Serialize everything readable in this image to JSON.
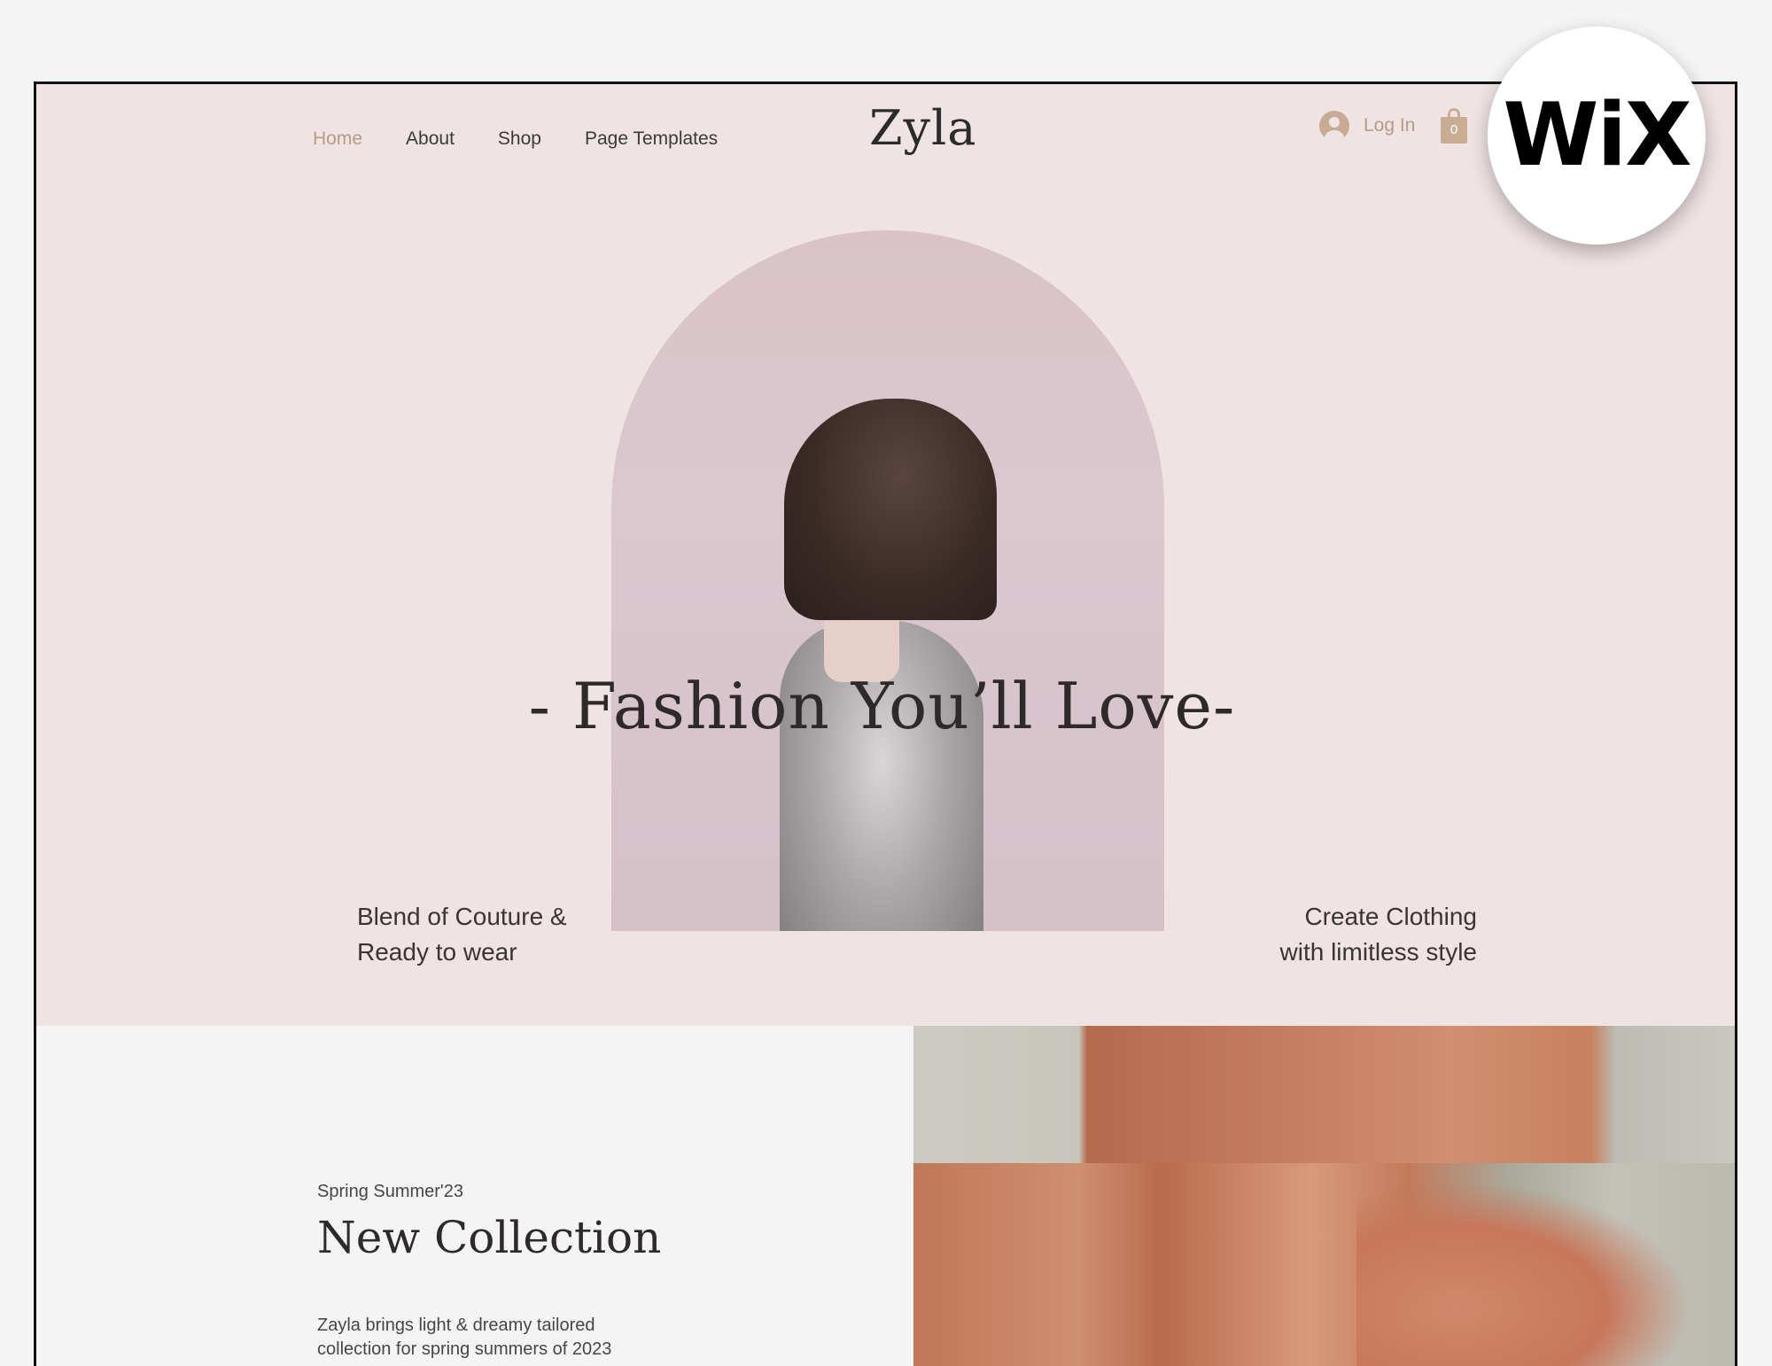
{
  "nav": {
    "items": [
      {
        "label": "Home",
        "active": true
      },
      {
        "label": "About"
      },
      {
        "label": "Shop"
      },
      {
        "label": "Page Templates"
      }
    ]
  },
  "header": {
    "logo": "Zyla",
    "login_label": "Log In",
    "cart_count": "0"
  },
  "hero": {
    "headline": "- Fashion You’ll Love-",
    "left_tagline": [
      "Blend of Couture &",
      "Ready to wear"
    ],
    "right_tagline": [
      "Create Clothing",
      "with limitless style"
    ]
  },
  "collection": {
    "season": "Spring Summer'23",
    "title": "New Collection",
    "description": "Zayla brings light & dreamy tailored collection for spring summers of 2023"
  },
  "badge": {
    "text": "WiX"
  },
  "colors": {
    "hero_bg": "#efe4e3",
    "accent": "#b79c86",
    "page_bg": "#f4f4f4",
    "text": "#2e2a2a"
  }
}
